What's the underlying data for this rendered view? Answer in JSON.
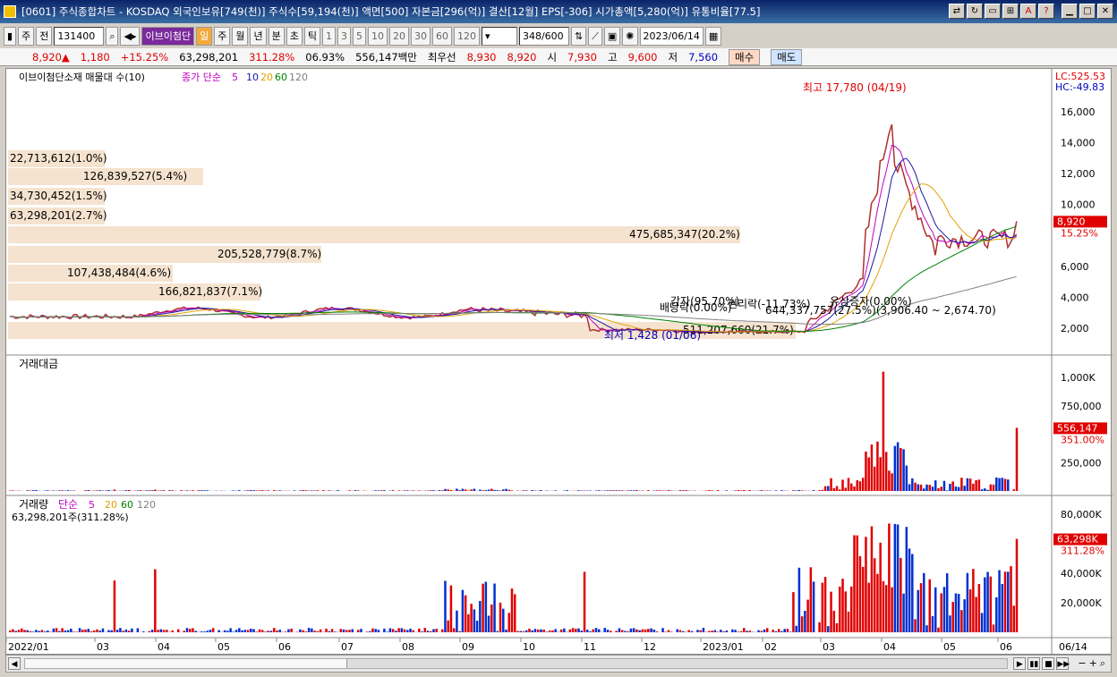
{
  "window": {
    "title": "[0601] 주식종합차트 - KOSDAQ 외국인보유[749(천)] 주식수[59,194(천)] 액면[500] 자본금[296(억)] 결산[12월] EPS[-306] 시가총액[5,280(억)] 유통비율[77.5]"
  },
  "toolbar": {
    "market": "주",
    "market2": "전",
    "code": "131400",
    "stock_name": "이브이첨단",
    "period_active": "일",
    "periods": [
      "주",
      "월",
      "년",
      "분",
      "초",
      "틱"
    ],
    "intervals": [
      "1",
      "3",
      "5",
      "10",
      "20",
      "30",
      "60",
      "120"
    ],
    "count": "348",
    "count_total": "/600",
    "date": "2023/06/14"
  },
  "quote": {
    "price": "8,920▲",
    "change": "1,180",
    "change_pct": "+15.25%",
    "volume": "63,298,201",
    "vol_ratio": "311.28%",
    "turnover_pct": "06.93%",
    "amount": "556,147백만",
    "best_label": "최우선",
    "ask": "8,930",
    "bid": "8,920",
    "open_label": "시",
    "open": "7,930",
    "high_label": "고",
    "high": "9,600",
    "low_label": "저",
    "low": "7,560",
    "buy_label": "매수",
    "sell_label": "매도"
  },
  "chart": {
    "price_pane_title": "이브이첨단소재 매물대 수(10)",
    "ma_label": "종가 단순",
    "ma_periods": [
      "5",
      "10",
      "20",
      "60",
      "120"
    ],
    "lc": "LC:525.53",
    "hc": "HC:-49.83",
    "price_axis": [
      "16,000",
      "14,000",
      "12,000",
      "10,000",
      "8,920",
      "6,000",
      "4,000",
      "2,000"
    ],
    "last_price_pct": "15.25%",
    "high_annot": "최고 17,780 (04/19)",
    "low_annot": "최저 1,428 (01/06)",
    "events": [
      "감자(95.70%)",
      "배당락(0.00%)",
      "권리락(-11.73%)",
      "유상증자(0.00%)"
    ],
    "event_line": "644,337,757(27.5%)(3,906.40 ~ 2,674.70)",
    "vp_labels": [
      "22,713,612(1.0%)",
      "126,839,527(5.4%)",
      "34,730,452(1.5%)",
      "63,298,201(2.7%)",
      "475,685,347(20.2%)",
      "205,528,779(8.7%)",
      "107,438,484(4.6%)",
      "166,821,837(7.1%)",
      "511,207,660(21.7%)"
    ],
    "amount_pane_title": "거래대금",
    "amount_axis": [
      "1,000K",
      "750,000",
      "556,147",
      "351.00%",
      "250,000"
    ],
    "volume_pane_title": "거래량",
    "volume_ma_label": "단순",
    "volume_ma_periods": [
      "5",
      "20",
      "60",
      "120"
    ],
    "volume_sub": "63,298,201주(311.28%)",
    "volume_axis": [
      "80,000K",
      "63,298K",
      "311.28%",
      "40,000K",
      "20,000K"
    ],
    "x_axis": [
      "2022/01",
      "03",
      "04",
      "05",
      "06",
      "07",
      "08",
      "09",
      "10",
      "11",
      "12",
      "2023/01",
      "02",
      "03",
      "04",
      "05",
      "06",
      "06/14"
    ],
    "colors": {
      "up": "#e00000",
      "down": "#0030d0",
      "ma5": "#c000c0",
      "ma10": "#1a1aa0",
      "ma20": "#e0a000",
      "ma60": "#008000",
      "ma120": "#808080",
      "vp": "#f5e3cf"
    }
  }
}
